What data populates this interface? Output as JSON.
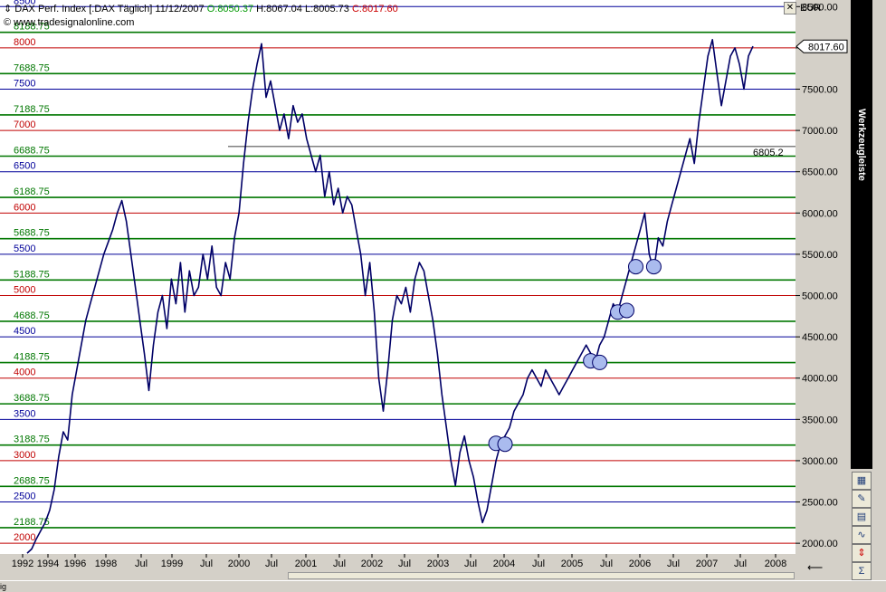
{
  "header": {
    "instrument": "DAX Perf. Index [.DAX",
    "period": "Täglich]",
    "date": "11/12/2007",
    "open": "O:8050.37",
    "high": "H:8067.04",
    "low": "L:8005.73",
    "close": "C:8017.60",
    "copyright": "© www.tradesignalonline.com",
    "currency": "EUR"
  },
  "current_price_label": "8017.60",
  "annotation_label": "6805.2",
  "toolbar": {
    "title": "Werkzeugleiste",
    "buttons": [
      "table-icon",
      "wrench-icon",
      "note-icon",
      "indicator-icon",
      "updown-icon",
      "sigma-icon"
    ]
  },
  "statusbar_text": "ig",
  "colors": {
    "price_line": "#000066",
    "red_line": "#c00000",
    "blue_line": "#000099",
    "green_line": "#007700",
    "circle_fill": "#aabbee"
  },
  "chart_data": {
    "type": "line",
    "title": "DAX Perf. Index",
    "xlabel": "",
    "ylabel": "EUR",
    "ylim": [
      1870,
      8580
    ],
    "y_ticks": [
      "8500.00",
      "8000.00",
      "7500.00",
      "7000.00",
      "6500.00",
      "6000.00",
      "5500.00",
      "5000.00",
      "4500.00",
      "4000.00",
      "3500.00",
      "3000.00",
      "2500.00",
      "2000.00"
    ],
    "x_ticks": [
      "1992",
      "1994",
      "1996",
      "1998",
      "Jul",
      "1999",
      "Jul",
      "2000",
      "Jul",
      "2001",
      "Jul",
      "2002",
      "Jul",
      "2003",
      "Jul",
      "2004",
      "Jul",
      "2005",
      "Jul",
      "2006",
      "Jul",
      "2007",
      "Jul",
      "2008"
    ],
    "hlines": [
      {
        "label": "8500",
        "value": 8500,
        "color": "blue"
      },
      {
        "label": "8188.75",
        "value": 8188.75,
        "color": "green"
      },
      {
        "label": "8000",
        "value": 8000,
        "color": "red"
      },
      {
        "label": "7688.75",
        "value": 7688.75,
        "color": "green"
      },
      {
        "label": "7500",
        "value": 7500,
        "color": "blue"
      },
      {
        "label": "7188.75",
        "value": 7188.75,
        "color": "green"
      },
      {
        "label": "7000",
        "value": 7000,
        "color": "red"
      },
      {
        "label": "6688.75",
        "value": 6688.75,
        "color": "green"
      },
      {
        "label": "6500",
        "value": 6500,
        "color": "blue"
      },
      {
        "label": "6188.75",
        "value": 6188.75,
        "color": "green"
      },
      {
        "label": "6000",
        "value": 6000,
        "color": "red"
      },
      {
        "label": "5688.75",
        "value": 5688.75,
        "color": "green"
      },
      {
        "label": "5500",
        "value": 5500,
        "color": "blue"
      },
      {
        "label": "5188.75",
        "value": 5188.75,
        "color": "green"
      },
      {
        "label": "5000",
        "value": 5000,
        "color": "red"
      },
      {
        "label": "4688.75",
        "value": 4688.75,
        "color": "green"
      },
      {
        "label": "4500",
        "value": 4500,
        "color": "blue"
      },
      {
        "label": "4188.75",
        "value": 4188.75,
        "color": "green"
      },
      {
        "label": "4000",
        "value": 4000,
        "color": "red"
      },
      {
        "label": "3688.75",
        "value": 3688.75,
        "color": "green"
      },
      {
        "label": "3500",
        "value": 3500,
        "color": "blue"
      },
      {
        "label": "3188.75",
        "value": 3188.75,
        "color": "green"
      },
      {
        "label": "3000",
        "value": 3000,
        "color": "red"
      },
      {
        "label": "2688.75",
        "value": 2688.75,
        "color": "green"
      },
      {
        "label": "2500",
        "value": 2500,
        "color": "blue"
      },
      {
        "label": "2188.75",
        "value": 2188.75,
        "color": "green"
      },
      {
        "label": "2000",
        "value": 2000,
        "color": "red"
      }
    ],
    "series": [
      {
        "values": [
          1880,
          1930,
          2050,
          2150,
          2250,
          2400,
          2650,
          3050,
          3350,
          3250,
          3800,
          4100,
          4400,
          4700,
          4900,
          5100,
          5300,
          5500,
          5650,
          5800,
          6000,
          6150,
          5900,
          5500,
          5100,
          4700,
          4300,
          3850,
          4400,
          4800,
          5000,
          4600,
          5200,
          4900,
          5400,
          4800,
          5300,
          5000,
          5100,
          5500,
          5200,
          5600,
          5100,
          5000,
          5400,
          5200,
          5700,
          6000,
          6600,
          7100,
          7500,
          7800,
          8050,
          7400,
          7600,
          7300,
          7000,
          7200,
          6900,
          7300,
          7100,
          7200,
          6900,
          6700,
          6500,
          6700,
          6200,
          6500,
          6100,
          6300,
          6000,
          6200,
          6100,
          5800,
          5500,
          5000,
          5400,
          4800,
          4000,
          3600,
          4100,
          4700,
          5000,
          4900,
          5100,
          4800,
          5200,
          5400,
          5300,
          5000,
          4700,
          4300,
          3800,
          3400,
          3000,
          2700,
          3100,
          3300,
          3000,
          2800,
          2500,
          2250,
          2400,
          2700,
          3000,
          3200,
          3300,
          3400,
          3600,
          3700,
          3800,
          4000,
          4100,
          4000,
          3900,
          4100,
          4000,
          3900,
          3800,
          3900,
          4000,
          4100,
          4200,
          4300,
          4400,
          4300,
          4200,
          4400,
          4500,
          4700,
          4900,
          4800,
          5000,
          5200,
          5400,
          5600,
          5800,
          6000,
          5500,
          5300,
          5700,
          5600,
          5900,
          6100,
          6300,
          6500,
          6700,
          6900,
          6600,
          7100,
          7500,
          7900,
          8100,
          7700,
          7300,
          7600,
          7900,
          8000,
          7800,
          7500,
          7900,
          8020
        ]
      }
    ],
    "highlight_points": [
      {
        "index": 104,
        "value": 3210
      },
      {
        "index": 106,
        "value": 3200
      },
      {
        "index": 125,
        "value": 4210
      },
      {
        "index": 127,
        "value": 4190
      },
      {
        "index": 131,
        "value": 4800
      },
      {
        "index": 133,
        "value": 4820
      },
      {
        "index": 135,
        "value": 5350
      },
      {
        "index": 139,
        "value": 5350
      }
    ]
  }
}
